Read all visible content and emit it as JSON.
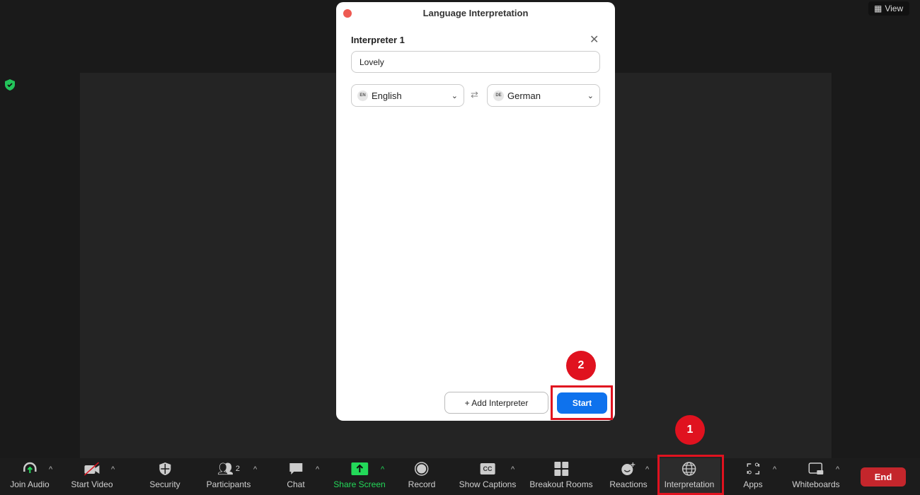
{
  "top": {
    "view_label": "View"
  },
  "dialog": {
    "title": "Language Interpretation",
    "interpreter_label": "Interpreter 1",
    "name_value": "Lovely",
    "from": {
      "code": "EN",
      "language": "English"
    },
    "to": {
      "code": "DE",
      "language": "German"
    },
    "add_label": "+ Add Interpreter",
    "start_label": "Start"
  },
  "steps": [
    "1",
    "2"
  ],
  "toolbar": {
    "join_audio": "Join Audio",
    "start_video": "Start Video",
    "security": "Security",
    "participants": "Participants",
    "participants_count": "2",
    "chat": "Chat",
    "share_screen": "Share Screen",
    "record": "Record",
    "show_captions": "Show Captions",
    "breakout_rooms": "Breakout Rooms",
    "reactions": "Reactions",
    "interpretation": "Interpretation",
    "apps": "Apps",
    "whiteboards": "Whiteboards",
    "end": "End"
  },
  "colors": {
    "accent": "#0e72ed",
    "highlight": "#e0121f",
    "share": "#23d959",
    "end": "#c4262c"
  }
}
